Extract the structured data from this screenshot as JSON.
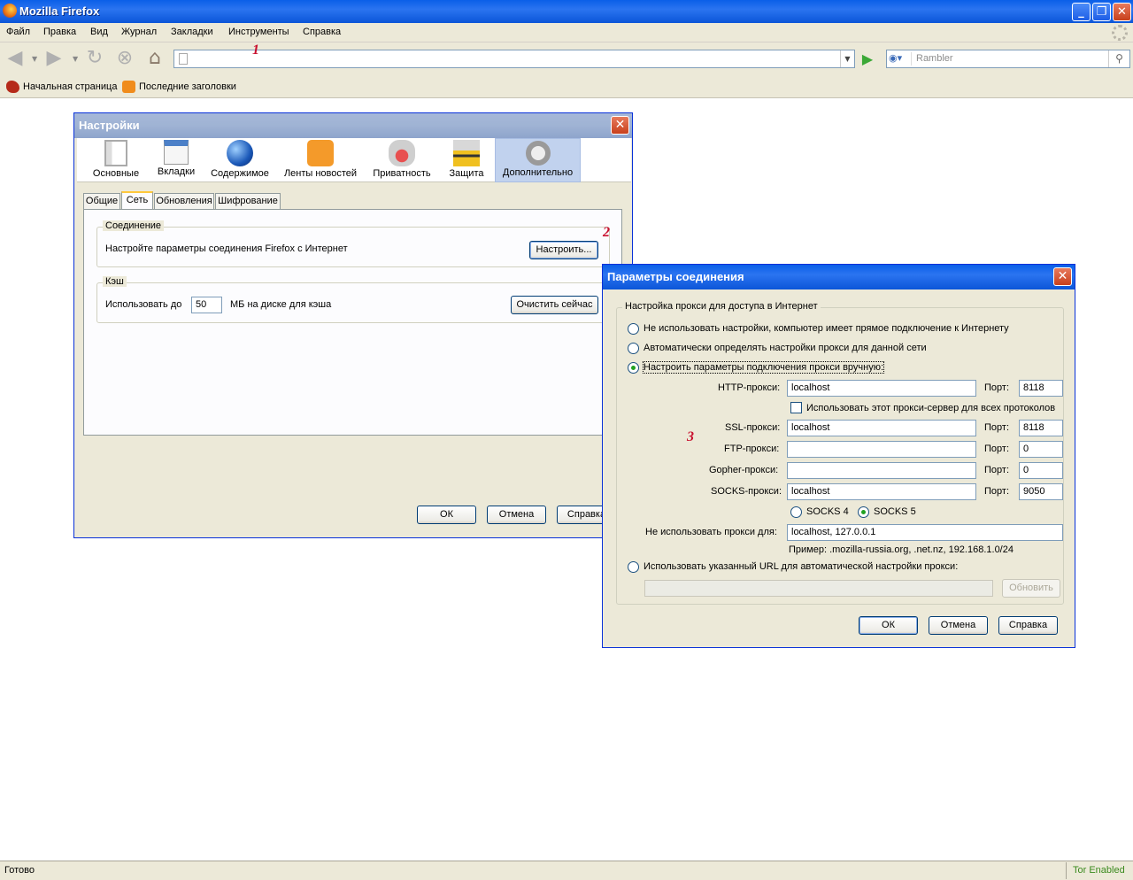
{
  "browser": {
    "title": "Mozilla Firefox",
    "menu": [
      "Файл",
      "Правка",
      "Вид",
      "Журнал",
      "Закладки",
      "Инструменты",
      "Справка"
    ],
    "url": "",
    "search_placeholder": "Rambler",
    "bookmarks": [
      "Начальная страница",
      "Последние заголовки"
    ],
    "status": "Готово",
    "status_right": "Tor Enabled"
  },
  "annotations": {
    "one": "1",
    "two": "2",
    "three": "3"
  },
  "settings": {
    "title": "Настройки",
    "panes": [
      "Основные",
      "Вкладки",
      "Содержимое",
      "Ленты новостей",
      "Приватность",
      "Защита",
      "Дополнительно"
    ],
    "active_pane": "Дополнительно",
    "tabs": [
      "Общие",
      "Сеть",
      "Обновления",
      "Шифрование"
    ],
    "active_tab": "Сеть",
    "connection": {
      "legend": "Соединение",
      "text": "Настройте параметры соединения Firefox с Интернет",
      "button": "Настроить..."
    },
    "cache": {
      "legend": "Кэш",
      "use_label": "Использовать до",
      "value": "50",
      "unit_text": "МБ на диске для кэша",
      "clear_button": "Очистить сейчас"
    },
    "buttons": {
      "ok": "ОК",
      "cancel": "Отмена",
      "help": "Справка"
    }
  },
  "connection_dialog": {
    "title": "Параметры соединения",
    "group_label": "Настройка прокси для доступа в Интернет",
    "options": {
      "no_proxy": "Не использовать настройки, компьютер имеет прямое подключение к Интернету",
      "auto_detect": "Автоматически определять настройки прокси для данной сети",
      "manual": "Настроить параметры подключения прокси вручную:",
      "auto_url": "Использовать указанный URL для автоматической настройки прокси:"
    },
    "selected_option": "manual",
    "http": {
      "label": "HTTP-прокси:",
      "host": "localhost",
      "port_label": "Порт:",
      "port": "8118"
    },
    "use_for_all": "Использовать этот прокси-сервер для всех протоколов",
    "ssl": {
      "label": "SSL-прокси:",
      "host": "localhost",
      "port_label": "Порт:",
      "port": "8118"
    },
    "ftp": {
      "label": "FTP-прокси:",
      "host": "",
      "port_label": "Порт:",
      "port": "0"
    },
    "gopher": {
      "label": "Gopher-прокси:",
      "host": "",
      "port_label": "Порт:",
      "port": "0"
    },
    "socks": {
      "label": "SOCKS-прокси:",
      "host": "localhost",
      "port_label": "Порт:",
      "port": "9050"
    },
    "socks_versions": {
      "v4": "SOCKS 4",
      "v5": "SOCKS 5",
      "selected": "v5"
    },
    "no_proxy_for": {
      "label": "Не использовать прокси для:",
      "value": "localhost, 127.0.0.1"
    },
    "example": "Пример: .mozilla-russia.org, .net.nz, 192.168.1.0/24",
    "auto_url_value": "",
    "reload_button": "Обновить",
    "buttons": {
      "ok": "ОК",
      "cancel": "Отмена",
      "help": "Справка"
    }
  }
}
